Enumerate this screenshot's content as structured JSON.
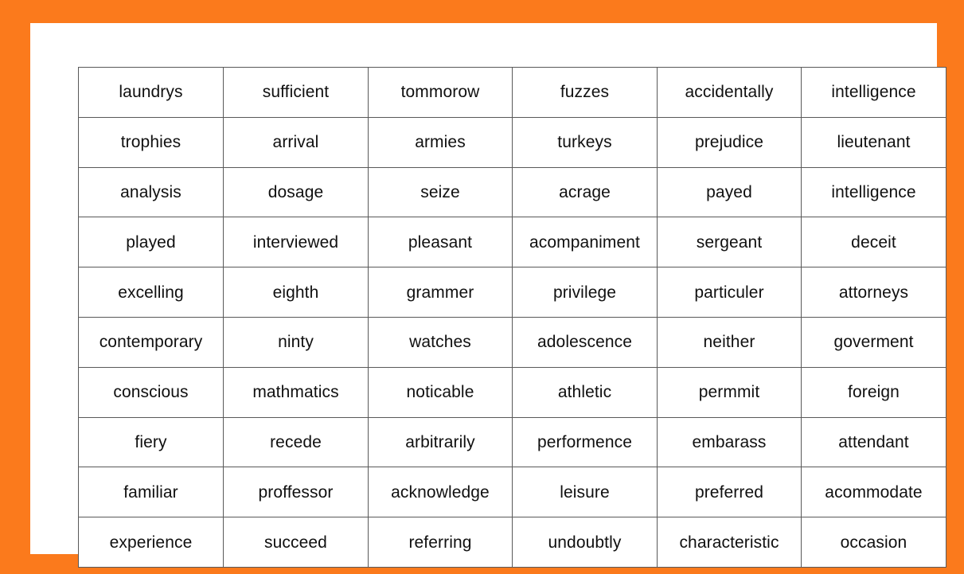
{
  "theme": {
    "frame_color": "#FB7A1C",
    "page_color": "#FFFFFF",
    "grid_line_color": "#595959",
    "text_color": "#101010"
  },
  "table": {
    "rows": 10,
    "columns": 6,
    "cells": [
      [
        "laundrys",
        "sufficient",
        "tommorow",
        "fuzzes",
        "accidentally",
        "intelligence"
      ],
      [
        "trophies",
        "arrival",
        "armies",
        "turkeys",
        "prejudice",
        "lieutenant"
      ],
      [
        "analysis",
        "dosage",
        "seize",
        "acrage",
        "payed",
        "intelligence"
      ],
      [
        "played",
        "interviewed",
        "pleasant",
        "acompaniment",
        "sergeant",
        "deceit"
      ],
      [
        "excelling",
        "eighth",
        "grammer",
        "privilege",
        "particuler",
        "attorneys"
      ],
      [
        "contemporary",
        "ninty",
        "watches",
        "adolescence",
        "neither",
        "goverment"
      ],
      [
        "conscious",
        "mathmatics",
        "noticable",
        "athletic",
        "permmit",
        "foreign"
      ],
      [
        "fiery",
        "recede",
        "arbitrarily",
        "performence",
        "embarass",
        "attendant"
      ],
      [
        "familiar",
        "proffessor",
        "acknowledge",
        "leisure",
        "preferred",
        "acommodate"
      ],
      [
        "experience",
        "succeed",
        "referring",
        "undoubtly",
        "characteristic",
        "occasion"
      ]
    ]
  }
}
